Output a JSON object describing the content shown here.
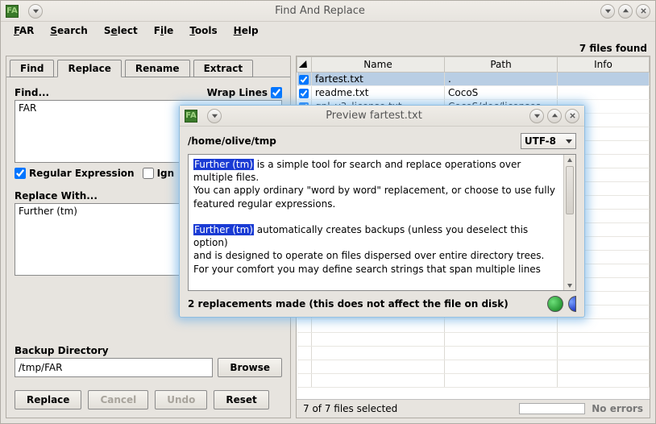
{
  "window": {
    "title": "Find And Replace"
  },
  "menu": {
    "far": "FAR",
    "search": "Search",
    "select": "Select",
    "file": "File",
    "tools": "Tools",
    "help": "Help"
  },
  "files_found": "7 files found",
  "tabs": {
    "find": "Find",
    "replace": "Replace",
    "rename": "Rename",
    "extract": "Extract",
    "active": "replace"
  },
  "find": {
    "label": "Find...",
    "wrap_label": "Wrap Lines",
    "wrap_checked": true,
    "value": "FAR",
    "regex_label": "Regular Expression",
    "regex_checked": true,
    "ignore_label": "Ign",
    "ignore_checked": false
  },
  "replace": {
    "label": "Replace With...",
    "value": "Further (tm)"
  },
  "backup": {
    "label": "Backup Directory",
    "value": "/tmp/FAR",
    "browse": "Browse"
  },
  "buttons": {
    "replace": "Replace",
    "cancel": "Cancel",
    "undo": "Undo",
    "reset": "Reset"
  },
  "table": {
    "cols": {
      "name": "Name",
      "path": "Path",
      "info": "Info"
    },
    "rows": [
      {
        "checked": true,
        "name": "fartest.txt",
        "path": ".",
        "info": "",
        "selected": true
      },
      {
        "checked": true,
        "name": "readme.txt",
        "path": "CocoS",
        "info": ""
      },
      {
        "checked": true,
        "name": "gpl_v3_license.txt",
        "path": "CocoS/doc/licenses",
        "info": ""
      }
    ]
  },
  "status": {
    "selected": "7 of 7 files selected",
    "errors": "No errors"
  },
  "preview": {
    "title": "Preview fartest.txt",
    "path": "/home/olive/tmp",
    "encoding": "UTF-8",
    "highlight": "Further (tm)",
    "seg1": " is a simple tool for search and replace operations over multiple files.",
    "seg2": "You can apply ordinary \"word by word\" replacement, or choose to use fully featured regular expressions.",
    "seg3": " automatically creates backups (unless you deselect this option)",
    "seg4": "and is designed to operate on files dispersed over entire directory trees.",
    "seg5": "For your comfort you may define search strings that span multiple lines",
    "status": "2 replacements made (this does not affect the file on disk)"
  }
}
